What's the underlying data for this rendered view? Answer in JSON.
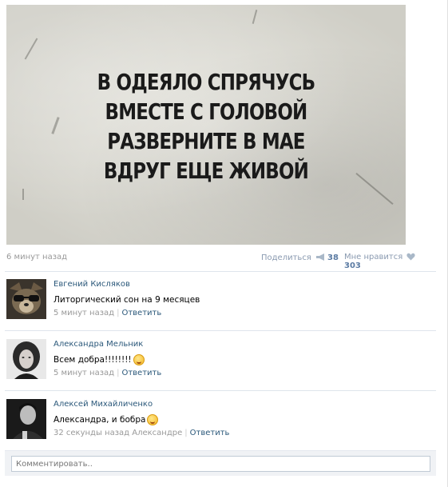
{
  "post": {
    "quote_lines": [
      "В ОДЕЯЛО СПРЯЧУСЬ",
      "ВМЕСТЕ С ГОЛОВОЙ",
      "РАЗВЕРНИТЕ В МАЕ",
      "ВДРУГ ЕЩЕ ЖИВОЙ"
    ],
    "time": "6 минут назад",
    "share_label": "Поделиться",
    "share_count": "38",
    "like_label": "Мне нравится",
    "like_count": "303"
  },
  "comments": [
    {
      "author": "Евгений Кисляков",
      "text": "Литоргический сон на 9 месяцев",
      "time": "5 минут назад",
      "reply_label": "Ответить",
      "emoji": ""
    },
    {
      "author": "Александра Мельник",
      "text": "Всем добра!!!!!!!!",
      "time": "5 минут назад",
      "reply_label": "Ответить",
      "emoji": "smile"
    },
    {
      "author": "Алексей Михайличенко",
      "text": "Александра, и бобра",
      "time": "32 секунды назад Александре",
      "reply_label": "Ответить",
      "emoji": "grin"
    }
  ],
  "reply_box": {
    "placeholder": "Комментировать.."
  },
  "colors": {
    "link": "#2b587a",
    "meta": "#999999",
    "counter": "#5b7ba3"
  }
}
